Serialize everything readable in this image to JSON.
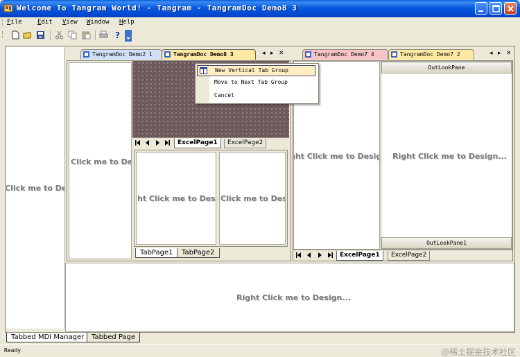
{
  "window": {
    "title": "Welcome To Tangram World! - Tangram - TangramDoc Demo8 3"
  },
  "menu": [
    "File",
    "Edit",
    "View",
    "Window",
    "Help"
  ],
  "toolbar_icons": [
    "new-icon",
    "open-icon",
    "save-icon",
    "cut-icon",
    "copy-icon",
    "paste-icon",
    "print-icon",
    "help-icon",
    "overflow-icon"
  ],
  "design_text": {
    "left_pane": "Click me to De",
    "excel_inner_left": "ht Click me to Desig",
    "excel_inner_right": "Click me to Des",
    "doc_left_strip": "Click me to Des",
    "right_doc_left": "ght Click me to Desig",
    "outlook": "Right Click me to Design...",
    "bottom": "Right Click me to Design..."
  },
  "left_group": {
    "tabs": [
      "TangramDoc Demo2 1",
      "TangramDoc Demo8 3"
    ],
    "nav": [
      "◂",
      "▸",
      "✕"
    ],
    "excel_tabs": [
      "ExcelPage1",
      "ExcelPage2"
    ],
    "inner_tabs": [
      "TabPage1",
      "TabPage2"
    ]
  },
  "right_group": {
    "tabs": [
      "TangramDoc Demo7 4",
      "TangramDoc Demo7 2"
    ],
    "nav": [
      "◂",
      "▸",
      "✕"
    ],
    "outlook_top": "OutLookPane",
    "outlook_bottom": "OutLookPane1",
    "excel_tabs": [
      "ExcelPage1",
      "ExcelPage2"
    ]
  },
  "context_menu": {
    "items": [
      "New Vertical Tab Group",
      "Move to Next Tab Group",
      "Cancel"
    ]
  },
  "mdi_tabs": [
    "Tabbed MDI Manager",
    "Tabbed Page"
  ],
  "status": {
    "text": "Ready",
    "watermark": "@稀土掘金技术社区"
  },
  "colors": {
    "titlebar": "#0858e0",
    "tab_pink": "#f6c4c4",
    "tab_yellow": "#fde9a2",
    "tab_blue": "#cfe0f7",
    "menu_highlight": "#ffeec2",
    "dotted_canvas": "#6e5a5c"
  }
}
